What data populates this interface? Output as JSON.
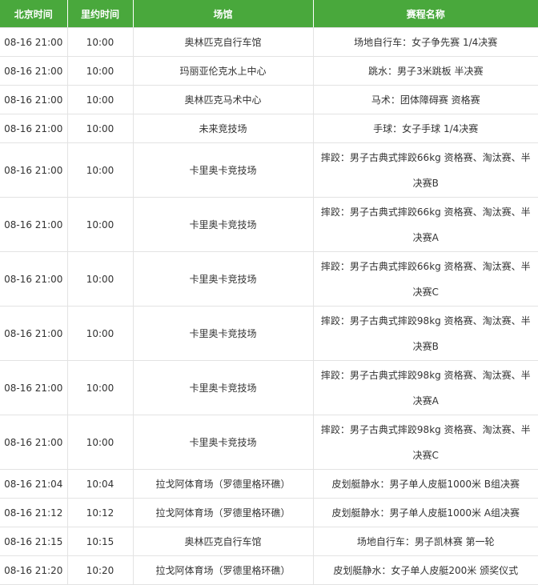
{
  "headers": {
    "beijing_time": "北京时间",
    "rio_time": "里约时间",
    "venue": "场馆",
    "event": "赛程名称"
  },
  "rows": [
    {
      "beijing": "08-16 21:00",
      "rio": "10:00",
      "venue": "奥林匹克自行车馆",
      "event": "场地自行车：女子争先赛 1/4决赛"
    },
    {
      "beijing": "08-16 21:00",
      "rio": "10:00",
      "venue": "玛丽亚伦克水上中心",
      "event": "跳水：男子3米跳板 半决赛"
    },
    {
      "beijing": "08-16 21:00",
      "rio": "10:00",
      "venue": "奥林匹克马术中心",
      "event": "马术：团体障碍赛 资格赛"
    },
    {
      "beijing": "08-16 21:00",
      "rio": "10:00",
      "venue": "未来竞技场",
      "event": "手球：女子手球 1/4决赛"
    },
    {
      "beijing": "08-16 21:00",
      "rio": "10:00",
      "venue": "卡里奥卡竞技场",
      "event": "摔跤：男子古典式摔跤66kg 资格赛、淘汰赛、半决赛B"
    },
    {
      "beijing": "08-16 21:00",
      "rio": "10:00",
      "venue": "卡里奥卡竞技场",
      "event": "摔跤：男子古典式摔跤66kg 资格赛、淘汰赛、半决赛A"
    },
    {
      "beijing": "08-16 21:00",
      "rio": "10:00",
      "venue": "卡里奥卡竞技场",
      "event": "摔跤：男子古典式摔跤66kg 资格赛、淘汰赛、半决赛C"
    },
    {
      "beijing": "08-16 21:00",
      "rio": "10:00",
      "venue": "卡里奥卡竞技场",
      "event": "摔跤：男子古典式摔跤98kg 资格赛、淘汰赛、半决赛B"
    },
    {
      "beijing": "08-16 21:00",
      "rio": "10:00",
      "venue": "卡里奥卡竞技场",
      "event": "摔跤：男子古典式摔跤98kg 资格赛、淘汰赛、半决赛A"
    },
    {
      "beijing": "08-16 21:00",
      "rio": "10:00",
      "venue": "卡里奥卡竞技场",
      "event": "摔跤：男子古典式摔跤98kg 资格赛、淘汰赛、半决赛C"
    },
    {
      "beijing": "08-16 21:04",
      "rio": "10:04",
      "venue": "拉戈阿体育场（罗德里格环礁）",
      "event": "皮划艇静水：男子单人皮艇1000米 B组决赛"
    },
    {
      "beijing": "08-16 21:12",
      "rio": "10:12",
      "venue": "拉戈阿体育场（罗德里格环礁）",
      "event": "皮划艇静水：男子单人皮艇1000米 A组决赛"
    },
    {
      "beijing": "08-16 21:15",
      "rio": "10:15",
      "venue": "奥林匹克自行车馆",
      "event": "场地自行车：男子凯林赛 第一轮"
    },
    {
      "beijing": "08-16 21:20",
      "rio": "10:20",
      "venue": "拉戈阿体育场（罗德里格环礁）",
      "event": "皮划艇静水：女子单人皮艇200米 颁奖仪式"
    }
  ]
}
